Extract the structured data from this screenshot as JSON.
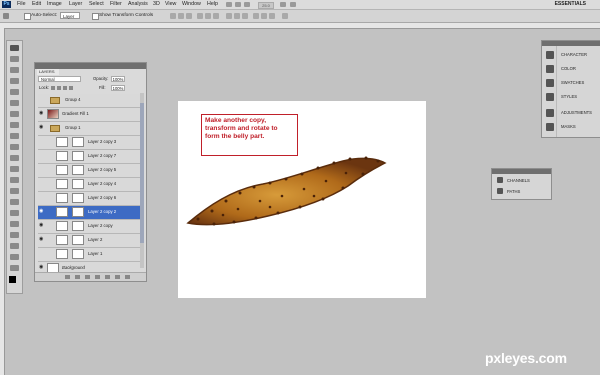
{
  "menu": [
    "File",
    "Edit",
    "Image",
    "Layer",
    "Select",
    "Filter",
    "Analysis",
    "3D",
    "View",
    "Window",
    "Help"
  ],
  "zoom": "25.0",
  "workspace": "ESSENTIALS",
  "options": {
    "auto_select_label": "Auto-Select:",
    "auto_select_value": "Layer",
    "transform_label": "Show Transform Controls"
  },
  "layers_panel": {
    "tab": "LAYERS",
    "blend_mode": "Normal",
    "opacity_label": "Opacity:",
    "opacity_value": "100%",
    "lock_label": "Lock:",
    "fill_label": "Fill:",
    "fill_value": "100%",
    "layers": [
      {
        "name": "Group 4",
        "type": "group",
        "visible": false,
        "selected": false
      },
      {
        "name": "Gradient Fill 1",
        "type": "fill",
        "visible": true,
        "selected": false
      },
      {
        "name": "Group 1",
        "type": "group",
        "visible": true,
        "selected": false
      },
      {
        "name": "Layer 2 copy 3",
        "type": "layer",
        "visible": false,
        "selected": false
      },
      {
        "name": "Layer 2 copy 7",
        "type": "layer",
        "visible": false,
        "selected": false
      },
      {
        "name": "Layer 2 copy 5",
        "type": "layer",
        "visible": false,
        "selected": false
      },
      {
        "name": "Layer 2 copy 4",
        "type": "layer",
        "visible": false,
        "selected": false
      },
      {
        "name": "Layer 2 copy 6",
        "type": "layer",
        "visible": false,
        "selected": false
      },
      {
        "name": "Layer 2 copy 2",
        "type": "layer",
        "visible": true,
        "selected": true
      },
      {
        "name": "Layer 2 copy",
        "type": "layer",
        "visible": true,
        "selected": false
      },
      {
        "name": "Layer 2",
        "type": "layer",
        "visible": true,
        "selected": false
      },
      {
        "name": "Layer 1",
        "type": "layer",
        "visible": false,
        "selected": false
      },
      {
        "name": "Background",
        "type": "background",
        "visible": true,
        "selected": false
      }
    ]
  },
  "right_panel": [
    "CHARACTER",
    "COLOR",
    "SWATCHES",
    "STYLES",
    "ADJUSTMENTS",
    "MASKS"
  ],
  "small_panel": [
    "CHANNELS",
    "PATHS"
  ],
  "callout_text": "Make another copy, transform and rotate to form the belly part.",
  "watermark": "pxleyes.com",
  "colors": {
    "callout": "#c0202a",
    "selected_layer": "#3d6bc4",
    "workspace_bg": "#c2c2c2"
  }
}
